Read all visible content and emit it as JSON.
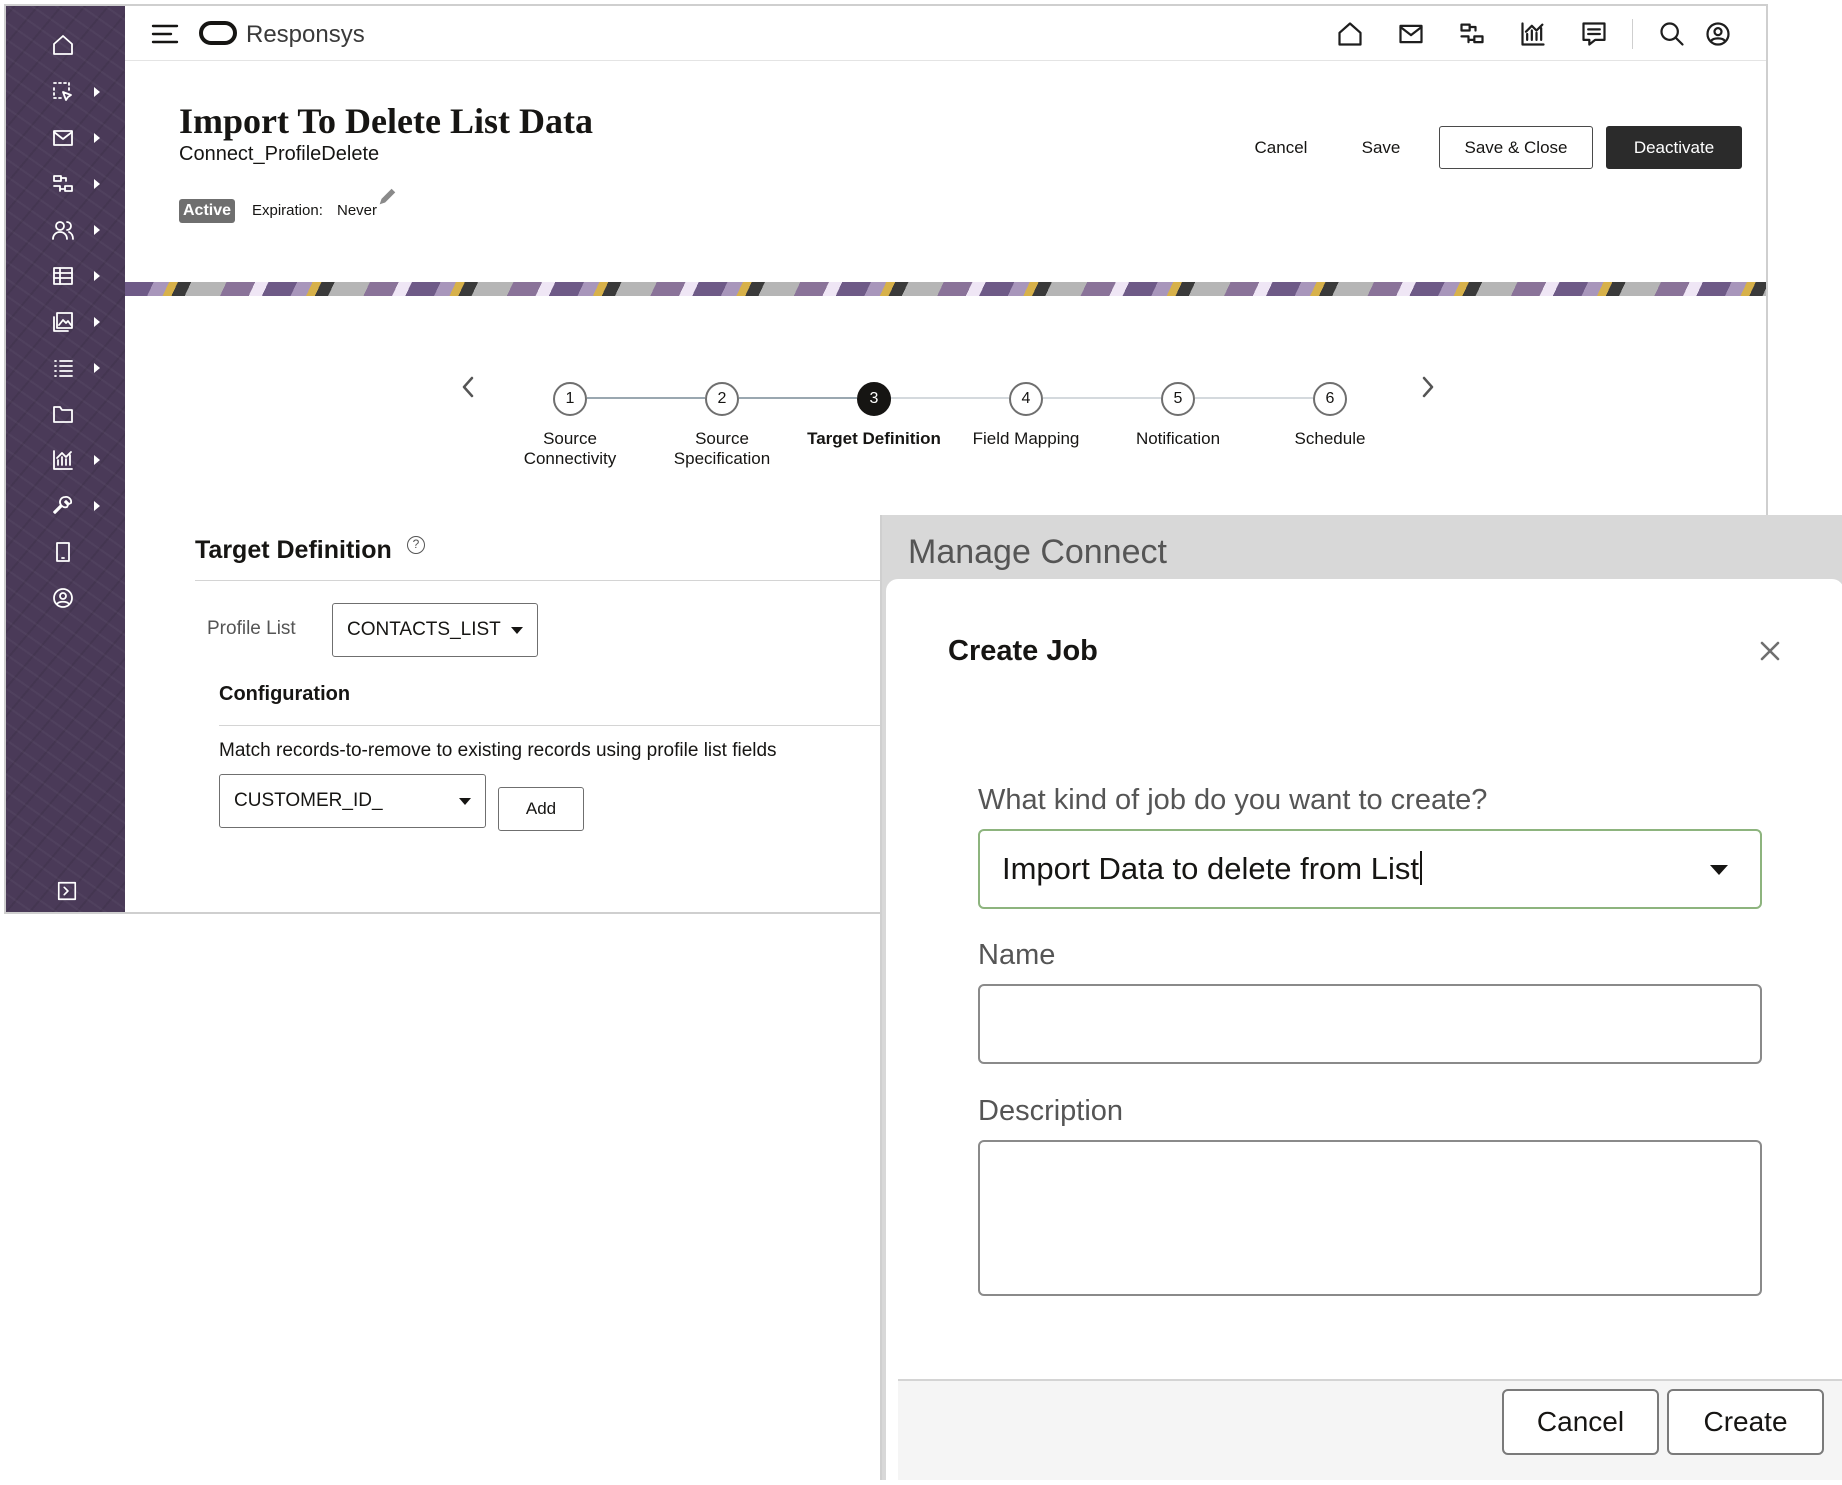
{
  "app": {
    "brand": "Responsys"
  },
  "sidebar": {
    "items": [
      {
        "icon": "home-icon",
        "arrow": false
      },
      {
        "icon": "select-icon",
        "arrow": true
      },
      {
        "icon": "mail-icon",
        "arrow": true
      },
      {
        "icon": "program-icon",
        "arrow": true
      },
      {
        "icon": "audience-icon",
        "arrow": true
      },
      {
        "icon": "table-icon",
        "arrow": true
      },
      {
        "icon": "content-icon",
        "arrow": true
      },
      {
        "icon": "list-icon",
        "arrow": true
      },
      {
        "icon": "folder-icon",
        "arrow": false
      },
      {
        "icon": "analytics-icon",
        "arrow": true
      },
      {
        "icon": "wrench-icon",
        "arrow": true
      },
      {
        "icon": "mobile-icon",
        "arrow": false
      },
      {
        "icon": "account-icon",
        "arrow": false
      }
    ]
  },
  "topbar": {
    "icons": [
      "home-icon",
      "mail-icon",
      "program-icon",
      "analytics-icon",
      "chat-icon",
      "search-icon",
      "user-icon"
    ]
  },
  "header": {
    "title": "Import To Delete List Data",
    "subtitle": "Connect_ProfileDelete",
    "status": "Active",
    "expiration_label": "Expiration:",
    "expiration_value": "Never",
    "cancel_label": "Cancel",
    "save_label": "Save",
    "save_close_label": "Save & Close",
    "deactivate_label": "Deactivate"
  },
  "stepper": {
    "current": 3,
    "steps": [
      {
        "number": "1",
        "label": "Source Connectivity"
      },
      {
        "number": "2",
        "label": "Source Specification"
      },
      {
        "number": "3",
        "label": "Target Definition"
      },
      {
        "number": "4",
        "label": "Field Mapping"
      },
      {
        "number": "5",
        "label": "Notification"
      },
      {
        "number": "6",
        "label": "Schedule"
      }
    ]
  },
  "target": {
    "title": "Target Definition",
    "help_glyph": "?",
    "profile_list_label": "Profile List",
    "profile_list_value": "CONTACTS_LIST",
    "config_title": "Configuration",
    "match_text": "Match records-to-remove to existing records using profile list fields",
    "match_field_value": "CUSTOMER_ID_",
    "add_label": "Add"
  },
  "manage_connect": {
    "title": "Manage Connect",
    "dialog": {
      "title": "Create Job",
      "job_kind_label": "What kind of job do you want to create?",
      "job_kind_value": "Import Data to delete from List",
      "name_label": "Name",
      "name_value": "",
      "description_label": "Description",
      "description_value": "",
      "cancel_label": "Cancel",
      "create_label": "Create"
    }
  },
  "colors": {
    "sidebar_bg": "#4a3a58",
    "dark_button": "#2b2b2b",
    "focus_border": "#8db47e",
    "status_badge": "#6f6f6f"
  }
}
